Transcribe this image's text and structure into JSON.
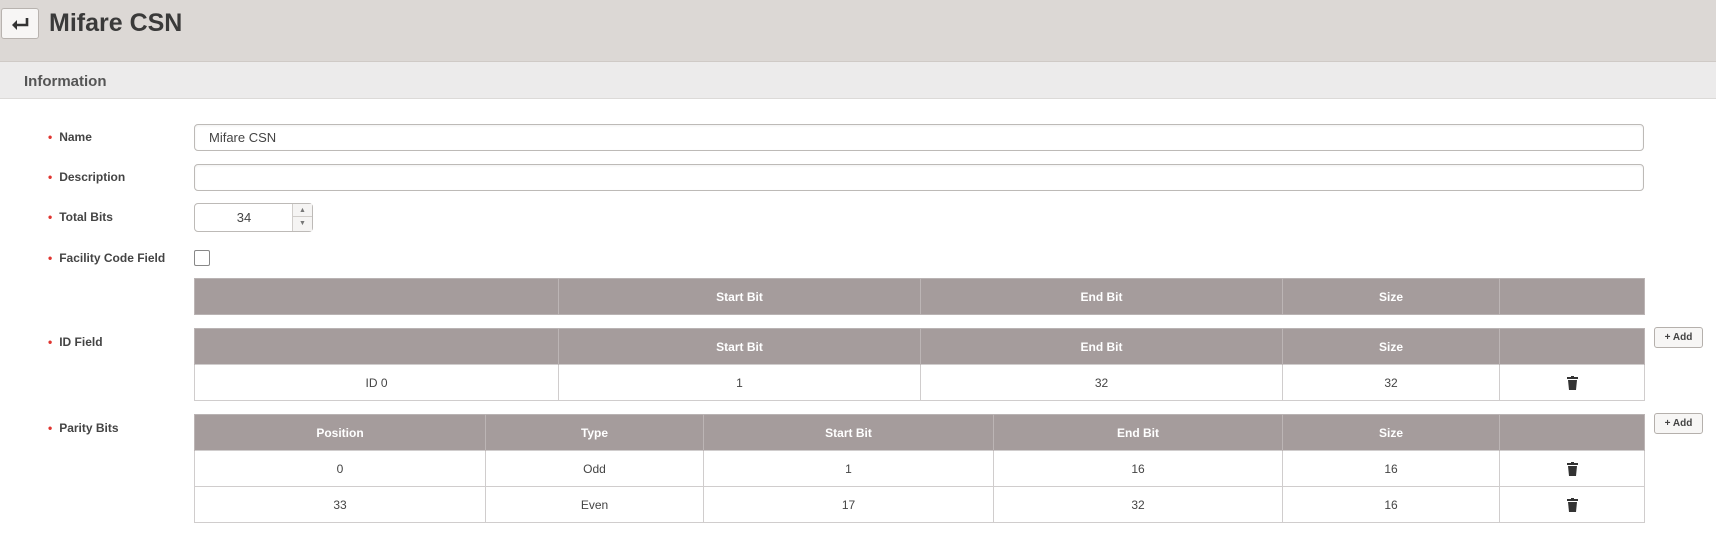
{
  "header": {
    "title": "Mifare CSN"
  },
  "section": {
    "title": "Information"
  },
  "form": {
    "name": {
      "label": "Name",
      "value": "Mifare CSN"
    },
    "description": {
      "label": "Description",
      "value": ""
    },
    "total_bits": {
      "label": "Total Bits",
      "value": "34"
    },
    "facility_code": {
      "label": "Facility Code Field",
      "checked": false
    },
    "id_field": {
      "label": "ID Field"
    },
    "parity_bits": {
      "label": "Parity Bits"
    }
  },
  "facility_table": {
    "columns": [
      "",
      "Start Bit",
      "End Bit",
      "Size",
      ""
    ]
  },
  "id_table": {
    "columns": [
      "",
      "Start Bit",
      "End Bit",
      "Size",
      ""
    ],
    "rows": [
      {
        "name": "ID 0",
        "start": "1",
        "end": "32",
        "size": "32"
      }
    ]
  },
  "parity_table": {
    "columns": [
      "Position",
      "Type",
      "Start Bit",
      "End Bit",
      "Size",
      ""
    ],
    "rows": [
      {
        "position": "0",
        "type": "Odd",
        "start": "1",
        "end": "16",
        "size": "16"
      },
      {
        "position": "33",
        "type": "Even",
        "start": "17",
        "end": "32",
        "size": "16"
      }
    ]
  },
  "buttons": {
    "add_label": "+ Add"
  },
  "icons": {
    "back": "return-arrow-icon",
    "delete": "trash-icon"
  }
}
